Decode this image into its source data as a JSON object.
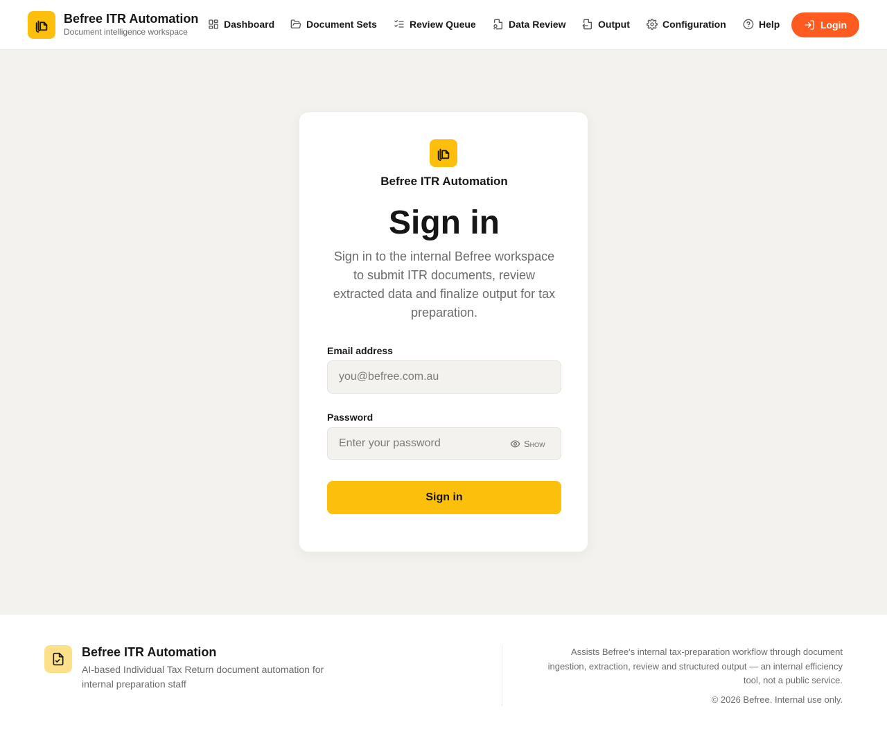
{
  "header": {
    "brand_title": "Befree ITR Automation",
    "brand_subtitle": "Document intelligence workspace",
    "nav": [
      {
        "label": "Dashboard",
        "icon": "dashboard-icon"
      },
      {
        "label": "Document Sets",
        "icon": "folder-open-icon"
      },
      {
        "label": "Review Queue",
        "icon": "checklist-icon"
      },
      {
        "label": "Data Review",
        "icon": "file-search-icon"
      },
      {
        "label": "Output",
        "icon": "file-output-icon"
      },
      {
        "label": "Configuration",
        "icon": "gear-icon"
      },
      {
        "label": "Help",
        "icon": "help-circle-icon"
      }
    ],
    "login_label": "Login",
    "login_icon": "login-icon"
  },
  "login_card": {
    "brand": "Befree ITR Automation",
    "title": "Sign in",
    "description": "Sign in to the internal Befree workspace to submit ITR documents, review extracted data and finalize output for tax preparation.",
    "email_label": "Email address",
    "email_placeholder": "you@befree.com.au",
    "password_label": "Password",
    "password_placeholder": "Enter your password",
    "show_label": "Show",
    "show_icon": "eye-icon",
    "submit_label": "Sign in"
  },
  "footer": {
    "title": "Befree ITR Automation",
    "description": "AI-based Individual Tax Return document automation for internal preparation staff",
    "about": "Assists Befree's internal tax-preparation workflow through document ingestion, extraction, review and structured output — an internal efficiency tool, not a public service.",
    "copyright": "© 2026 Befree. Internal use only."
  },
  "colors": {
    "accent_yellow": "#fcbf0b",
    "login_orange": "#ff5a1f",
    "page_background": "#f4f2ee"
  }
}
